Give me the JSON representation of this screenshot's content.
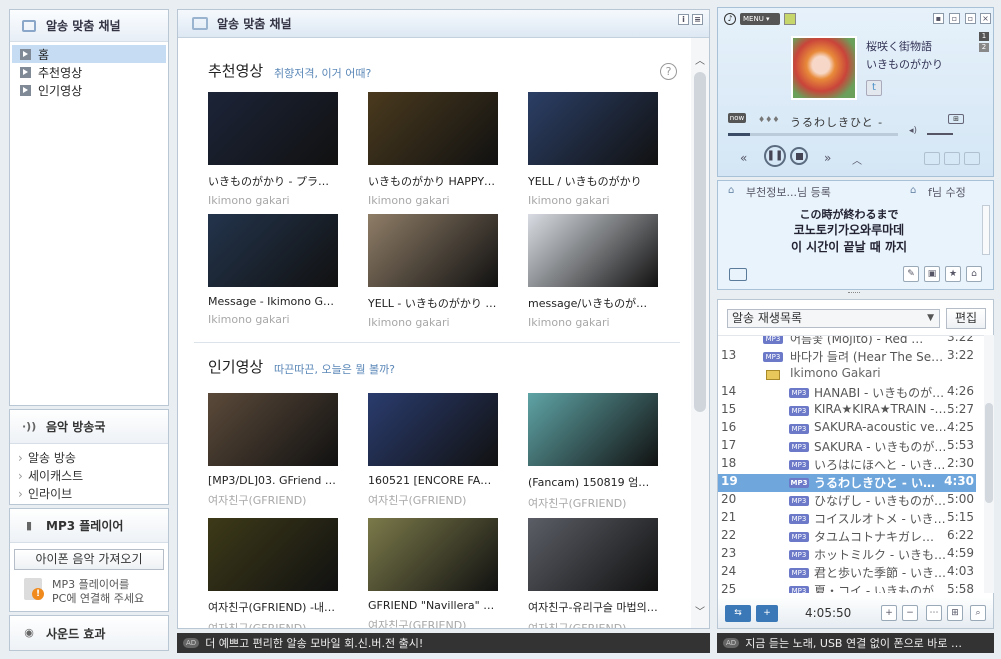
{
  "sidebar": {
    "channel_title": "알송 맞춤 채널",
    "nav": [
      {
        "label": "홈",
        "selected": true
      },
      {
        "label": "추천영상",
        "selected": false
      },
      {
        "label": "인기영상",
        "selected": false
      }
    ],
    "broadcast": {
      "title": "음악 방송국",
      "items": [
        "알송 방송",
        "세이캐스트",
        "인라이브"
      ]
    },
    "mp3": {
      "title": "MP3 플레이어",
      "button": "아이폰 음악 가져오기",
      "note_line1": "MP3 플레이어를",
      "note_line2": "PC에 연결해 주세요"
    },
    "sound": {
      "title": "사운드 효과"
    }
  },
  "center": {
    "title": "알송 맞춤 채널",
    "recommended": {
      "title": "추천영상",
      "subtitle": "취향저격, 이거 어때?",
      "videos": [
        {
          "title": "いきものがかり - プラネタ…",
          "artist": "Ikimono gakari",
          "thumb": "#1c2438"
        },
        {
          "title": "いきものがかり HAPPY S…",
          "artist": "Ikimono gakari",
          "thumb": "#4a3a1e"
        },
        {
          "title": "YELL / いきものがかり",
          "artist": "Ikimono gakari",
          "thumb": "#2b3f66"
        },
        {
          "title": "Message - Ikimono Gak…",
          "artist": "Ikimono gakari",
          "thumb": "#23344c"
        },
        {
          "title": "YELL - いきものがかり (…",
          "artist": "Ikimono gakari",
          "thumb": "#8f7d67"
        },
        {
          "title": "message/いきものがかり",
          "artist": "Ikimono gakari",
          "thumb": "#d9dde3"
        }
      ]
    },
    "popular": {
      "title": "인기영상",
      "subtitle": "따끈따끈, 오늘은 뭘 볼까?",
      "videos": [
        {
          "title": "[MP3/DL]03. GFriend (…",
          "artist": "여자친구(GFRIEND)",
          "thumb": "#5b4a3a"
        },
        {
          "title": "160521 [ENCORE FANC…",
          "artist": "여자친구(GFRIEND)",
          "thumb": "#2a3c6e"
        },
        {
          "title": "(Fancam) 150819 엄지…",
          "artist": "여자친구(GFRIEND)",
          "thumb": "#5fa4a6"
        },
        {
          "title": "여자친구(GFRIEND) -내…",
          "artist": "여자친구(GFRIEND)",
          "thumb": "#3d3a18"
        },
        {
          "title": "GFRIEND \"Navillera\" Mir…",
          "artist": "여자친구(GFRIEND)",
          "thumb": "#7b7a4a"
        },
        {
          "title": "여자친구-유리구슬 마법의…",
          "artist": "여자친구(GFRIEND)",
          "thumb": "#5b5e66"
        }
      ]
    },
    "ad": "더 예쁘고 편리한 알송 모바일 회.신.버.전 출시!"
  },
  "player": {
    "menu": "MENU",
    "song_title": "桜咲く街物語",
    "artist": "いきものがかり",
    "now_label": "now",
    "now_prefix": "♦♦♦",
    "now_song": "うるわしきひと -",
    "track_nums": [
      "1",
      "2"
    ]
  },
  "lyrics": {
    "register": "부천정보...님 등록",
    "edit": "f님 수정",
    "line1": "この時が終わるまで",
    "line2": "코노토키가오와루마데",
    "line3": "이 시간이 끝날 때 까지"
  },
  "playlist": {
    "name": "알송 재생목록",
    "edit_button": "편집",
    "partial_title": "어름꽃 (Mojito) - Red Velv…",
    "partial_dur": "3:22",
    "folder": "Ikimono Gakari",
    "rows": [
      {
        "n": "13",
        "title": "바다가 들려 (Hear The Se…",
        "dur": "3:22",
        "indent": false
      },
      {
        "n": "14",
        "title": "HANABI - いきものが…",
        "dur": "4:26",
        "indent": true
      },
      {
        "n": "15",
        "title": "KIRA★KIRA★TRAIN -…",
        "dur": "5:27",
        "indent": true
      },
      {
        "n": "16",
        "title": "SAKURA-acoustic ver…",
        "dur": "4:25",
        "indent": true
      },
      {
        "n": "17",
        "title": "SAKURA - いきものが…",
        "dur": "5:53",
        "indent": true
      },
      {
        "n": "18",
        "title": "いろはにほへと - いき…",
        "dur": "2:30",
        "indent": true
      },
      {
        "n": "19",
        "title": "うるわしきひと - い…",
        "dur": "4:30",
        "indent": true,
        "current": true
      },
      {
        "n": "20",
        "title": "ひなげし - いきものが…",
        "dur": "5:00",
        "indent": true
      },
      {
        "n": "21",
        "title": "コイスルオトメ - いき…",
        "dur": "5:15",
        "indent": true
      },
      {
        "n": "22",
        "title": "タユムコトナキガレ…",
        "dur": "6:22",
        "indent": true
      },
      {
        "n": "23",
        "title": "ホットミルク - いきも…",
        "dur": "4:59",
        "indent": true
      },
      {
        "n": "24",
        "title": "君と歩いた季節 - いき…",
        "dur": "4:03",
        "indent": true
      },
      {
        "n": "25",
        "title": "夏・コイ - いきものが…",
        "dur": "5:58",
        "indent": true
      }
    ],
    "badge": "MP3",
    "total": "4:05:50",
    "ad": "지금 듣는 노래, USB 연결 없이 폰으로 바로 …"
  },
  "colors": {
    "accent": "#6fa6dc",
    "badge": "#6b79c8"
  }
}
